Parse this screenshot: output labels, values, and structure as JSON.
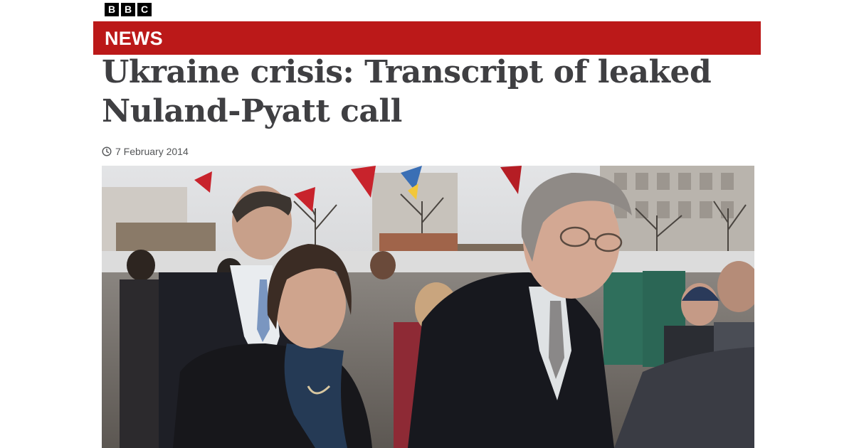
{
  "brand": {
    "logo_letters": [
      "B",
      "B",
      "C"
    ],
    "section_label": "NEWS",
    "bar_color": "#bb1919"
  },
  "article": {
    "headline": "Ukraine crisis: Transcript of leaked Nuland-Pyatt call",
    "date": "7 February 2014"
  },
  "image": {
    "icon": "news-photo"
  }
}
